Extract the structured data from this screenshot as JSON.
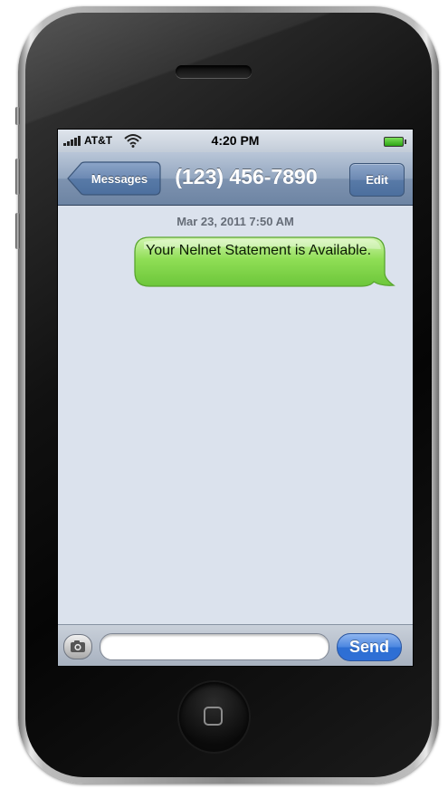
{
  "status_bar": {
    "carrier": "AT&T",
    "time": "4:20 PM",
    "signal_icon": "signal-bars-icon",
    "wifi_icon": "wifi-icon",
    "battery_icon": "battery-icon"
  },
  "nav_bar": {
    "back_label": "Messages",
    "title": "(123) 456-7890",
    "edit_label": "Edit"
  },
  "conversation": {
    "timestamp": "Mar 23, 2011 7:50 AM",
    "messages": [
      {
        "text": "Your Nelnet Statement is Available.",
        "direction": "outgoing",
        "color": "#7ed446"
      }
    ]
  },
  "composer": {
    "camera_icon": "camera-icon",
    "input_value": "",
    "send_label": "Send"
  },
  "colors": {
    "nav_bar": "#7e93b0",
    "screen_background": "#dbe2ed",
    "bubble_green": "#7ed446",
    "send_blue": "#2e6fd3"
  }
}
